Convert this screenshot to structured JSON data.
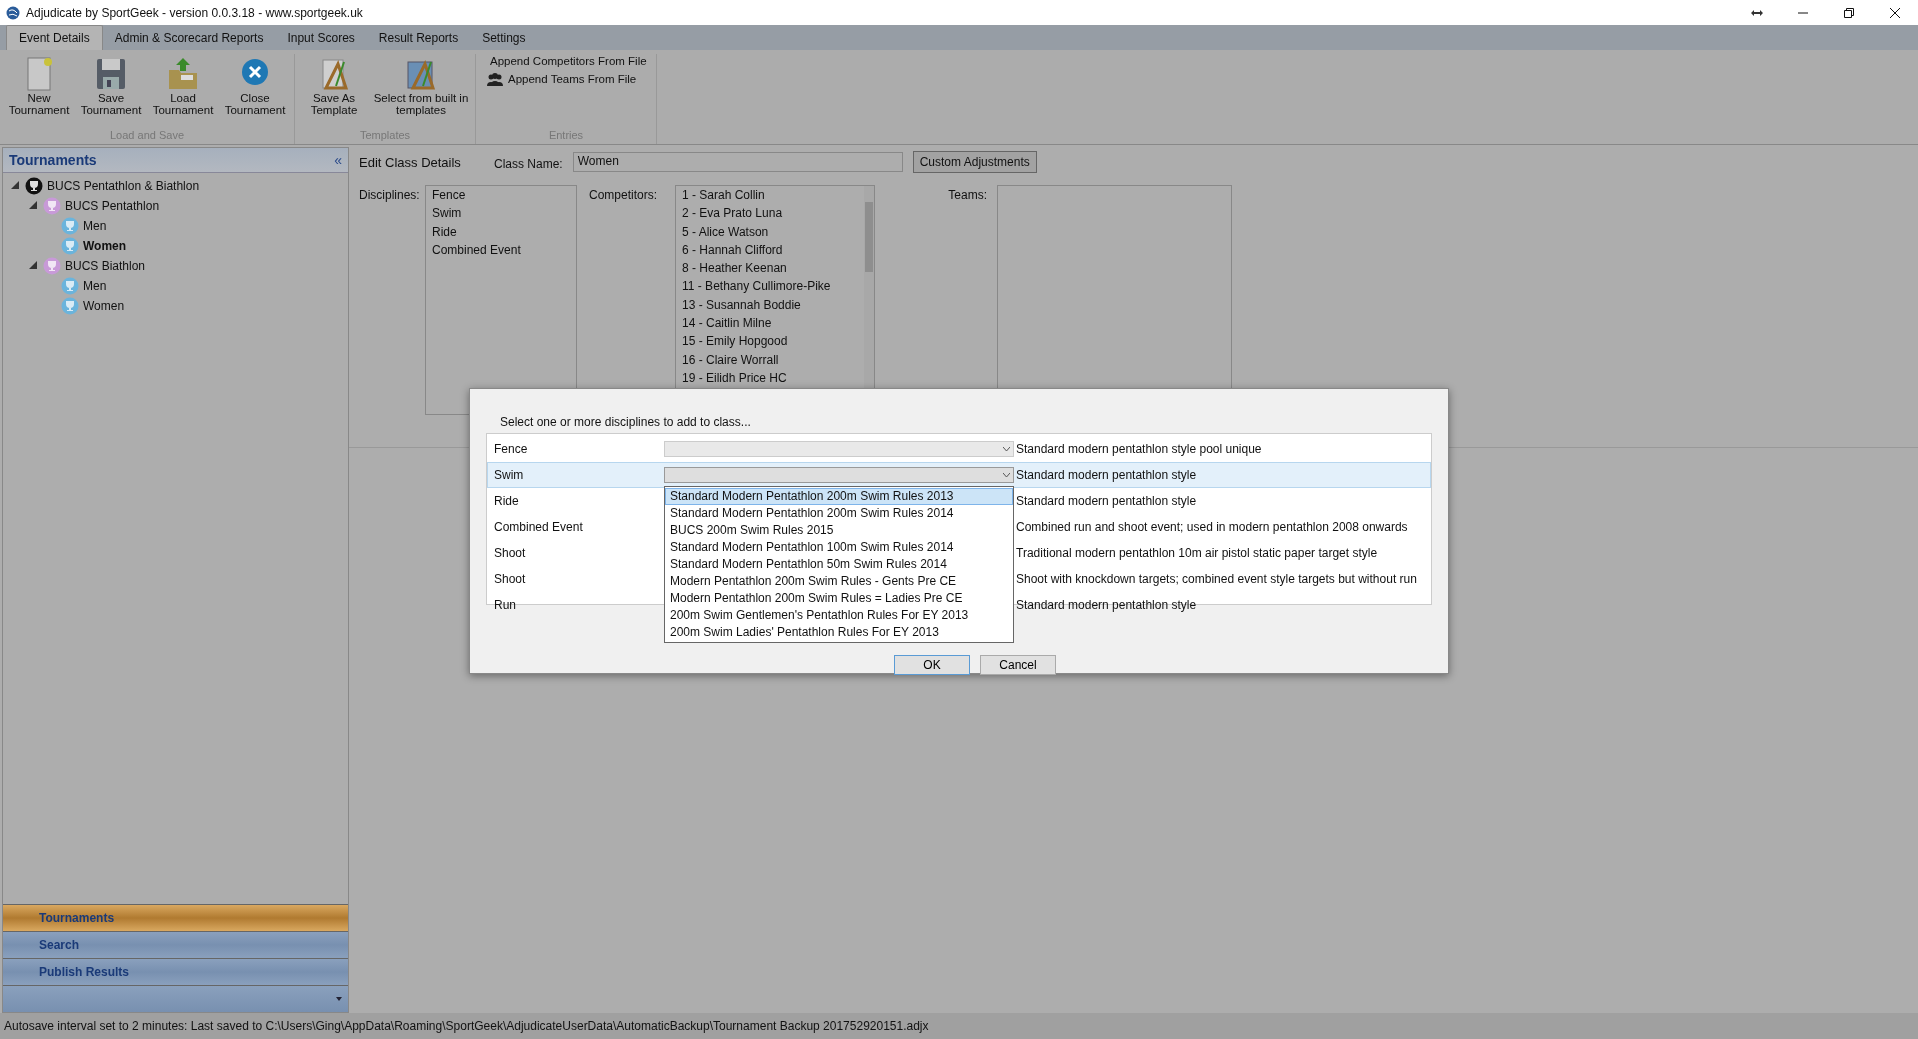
{
  "window": {
    "title": "Adjudicate by SportGeek -  version 0.0.3.18 - www.sportgeek.uk"
  },
  "ribbon_tabs": [
    {
      "label": "Event Details",
      "selected": true
    },
    {
      "label": "Admin & Scorecard Reports",
      "selected": false
    },
    {
      "label": "Input Scores",
      "selected": false
    },
    {
      "label": "Result Reports",
      "selected": false
    },
    {
      "label": "Settings",
      "selected": false
    }
  ],
  "ribbon_groups": [
    {
      "label": "Load and Save",
      "buttons": [
        {
          "label": "New Tournament",
          "kind": "new"
        },
        {
          "label": "Save Tournament",
          "kind": "save"
        },
        {
          "label": "Load Tournament",
          "kind": "load"
        },
        {
          "label": "Close Tournament",
          "kind": "close"
        }
      ]
    },
    {
      "label": "Templates",
      "buttons": [
        {
          "label": "Save As Template",
          "kind": "template"
        },
        {
          "label": "Select from built in templates",
          "kind": "templates"
        }
      ]
    },
    {
      "label": "Entries",
      "buttons": [
        {
          "label": "Append Competitors From File",
          "kind": "person"
        },
        {
          "label": "Append Teams From File",
          "kind": "people"
        }
      ]
    }
  ],
  "sidebar": {
    "title": "Tournaments",
    "collapse": "«",
    "tree": [
      {
        "label": "BUCS Pentathlon & Biathlon",
        "kind": "event",
        "expanded": true,
        "selected": false,
        "children": [
          {
            "label": "BUCS Pentathlon",
            "kind": "competition",
            "expanded": true,
            "selected": false,
            "children": [
              {
                "label": "Men",
                "kind": "class",
                "selected": false
              },
              {
                "label": "Women",
                "kind": "class",
                "selected": true
              }
            ]
          },
          {
            "label": "BUCS Biathlon",
            "kind": "competition",
            "expanded": true,
            "selected": false,
            "children": [
              {
                "label": "Men",
                "kind": "class",
                "selected": false
              },
              {
                "label": "Women",
                "kind": "class",
                "selected": false
              }
            ]
          }
        ]
      }
    ],
    "nav": [
      {
        "label": "Tournaments",
        "selected": true
      },
      {
        "label": "Search",
        "selected": false
      },
      {
        "label": "Publish Results",
        "selected": false
      }
    ]
  },
  "edit_class": {
    "title": "Edit Class Details",
    "class_name_label": "Class Name:",
    "class_name": "Women",
    "custom_button": "Custom Adjustments",
    "disciplines_label": "Disciplines:",
    "disciplines": [
      "Fence",
      "Swim",
      "Ride",
      "Combined Event"
    ],
    "competitors_label": "Competitors:",
    "competitors": [
      "1 -  Sarah Collin",
      "2 -  Eva Prato Luna",
      "5 -  Alice Watson",
      "6 -  Hannah Clifford",
      "8 -  Heather Keenan",
      "11 -  Bethany Cullimore-Pike",
      "13 -  Susannah Boddie",
      "14 -  Caitlin Milne",
      "15 -  Emily Hopgood",
      "16 -  Claire Worrall",
      "19 -  Eilidh Price HC"
    ],
    "teams_label": "Teams:"
  },
  "dialog": {
    "prompt": "Select one or more disciplines to add to class...",
    "rows": [
      {
        "name": "Fence",
        "description": "Standard modern pentathlon style pool unique",
        "selected": false,
        "open": false
      },
      {
        "name": "Swim",
        "description": "Standard modern pentathlon style",
        "selected": true,
        "open": true
      },
      {
        "name": "Ride",
        "description": "Standard modern pentathlon style",
        "selected": false,
        "open": false
      },
      {
        "name": "Combined Event",
        "description": "Combined run and shoot event; used in modern pentathlon 2008 onwards",
        "selected": false,
        "open": false
      },
      {
        "name": "Shoot",
        "description": "Traditional modern pentathlon 10m air pistol static paper target style",
        "selected": false,
        "open": false
      },
      {
        "name": "Shoot",
        "description": "Shoot with knockdown targets; combined event style targets but without run",
        "selected": false,
        "open": false
      },
      {
        "name": "Run",
        "description": "Standard modern pentathlon style",
        "selected": false,
        "open": false
      }
    ],
    "options": [
      {
        "label": "Standard Modern Pentathlon 200m Swim Rules 2013",
        "selected": true
      },
      {
        "label": "Standard Modern Pentathlon 200m Swim Rules 2014",
        "selected": false
      },
      {
        "label": "BUCS 200m Swim Rules 2015",
        "selected": false
      },
      {
        "label": "Standard Modern Pentathlon 100m Swim Rules 2014",
        "selected": false
      },
      {
        "label": "Standard Modern Pentathlon 50m Swim Rules 2014",
        "selected": false
      },
      {
        "label": "Modern Pentathlon 200m Swim Rules - Gents Pre CE",
        "selected": false
      },
      {
        "label": "Modern Pentathlon 200m Swim Rules = Ladies Pre CE",
        "selected": false
      },
      {
        "label": "200m Swim Gentlemen's Pentathlon Rules For EY 2013",
        "selected": false
      },
      {
        "label": "200m Swim Ladies' Pentathlon Rules For EY 2013",
        "selected": false
      }
    ],
    "buttons": [
      "OK",
      "Cancel"
    ]
  },
  "status_bar": "Autosave interval set to 2 minutes: Last saved to C:\\Users\\Ging\\AppData\\Roaming\\SportGeek\\AdjudicateUserData\\AutomaticBackup\\Tournament Backup 201752920151.adjx"
}
